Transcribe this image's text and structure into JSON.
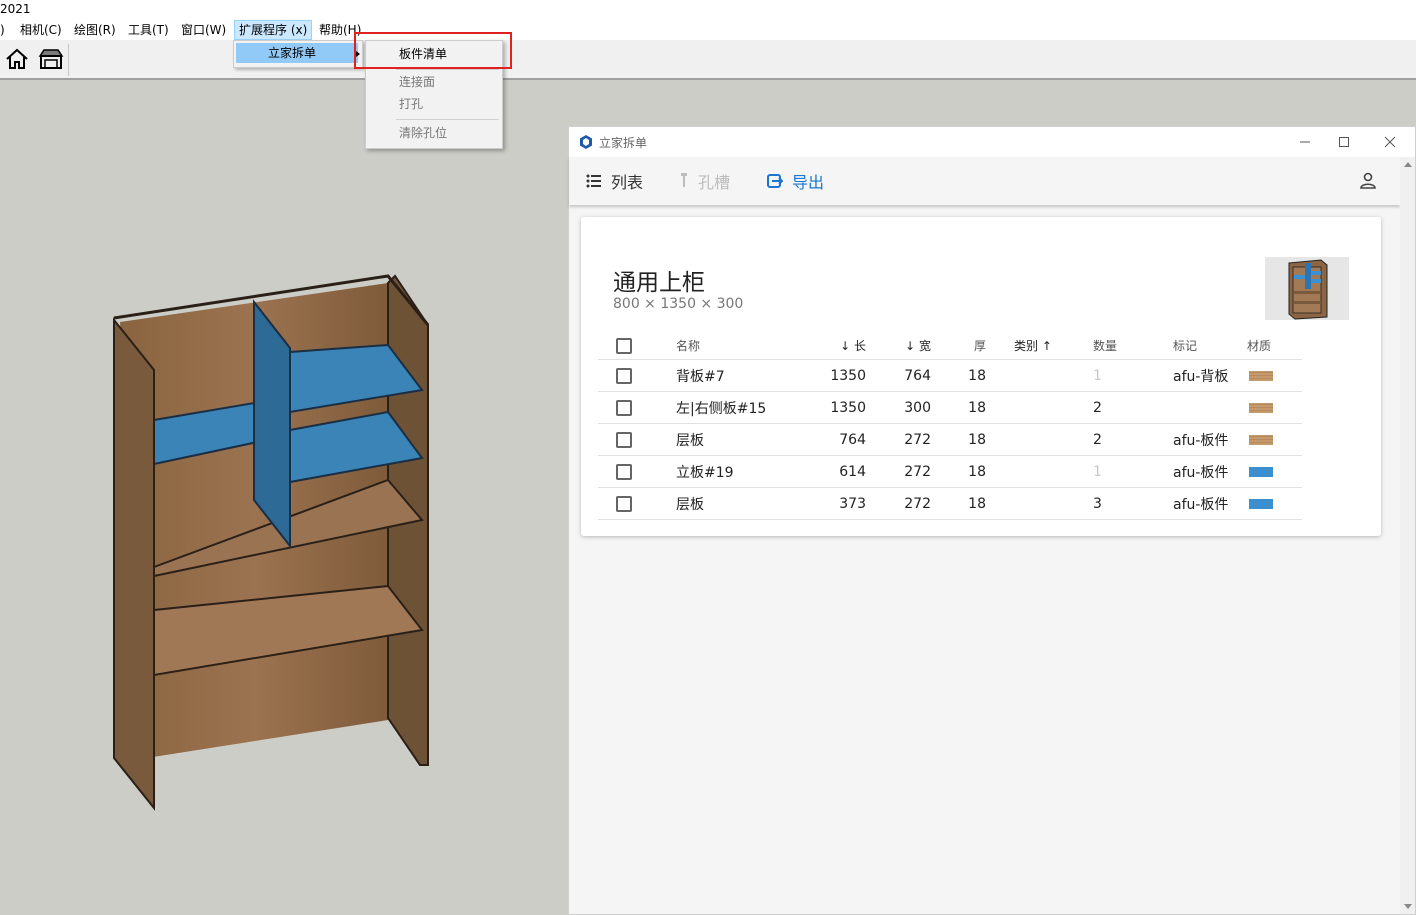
{
  "host": {
    "title_fragment": "2021",
    "menus": [
      {
        "label": ")"
      },
      {
        "label": "相机(C)"
      },
      {
        "label": "绘图(R)"
      },
      {
        "label": "工具(T)"
      },
      {
        "label": "窗口(W)"
      },
      {
        "label": "扩展程序 (x)"
      },
      {
        "label": "帮助(H)"
      }
    ],
    "submenu": {
      "label": "立家拆单"
    },
    "submenu_items": [
      {
        "label": "板件清单"
      },
      {
        "label": "连接面"
      },
      {
        "label": "打孔"
      },
      {
        "label": "清除孔位"
      }
    ],
    "toolbar_icons": [
      "home-icon",
      "warehouse-icon"
    ]
  },
  "plugin": {
    "window_title": "立家拆单",
    "window_controls": [
      "minimize",
      "maximize",
      "close"
    ],
    "toolbar": {
      "list_label": "列表",
      "slot_label": "孔槽",
      "export_label": "导出"
    },
    "cabinet": {
      "name": "通用上柜",
      "dimensions": "800 × 1350 × 300"
    },
    "columns": {
      "name": "名称",
      "length": "长",
      "width": "宽",
      "thickness": "厚",
      "category": "类别",
      "quantity": "数量",
      "mark": "标记",
      "material": "材质"
    },
    "rows": [
      {
        "name": "背板#7",
        "length": "1350",
        "width": "764",
        "thickness": "18",
        "quantity": "1",
        "mark": "afu-背板",
        "material": "wood",
        "qty_dim": true
      },
      {
        "name": "左|右侧板#15",
        "length": "1350",
        "width": "300",
        "thickness": "18",
        "quantity": "2",
        "mark": "",
        "material": "wood",
        "qty_dim": false
      },
      {
        "name": "层板",
        "length": "764",
        "width": "272",
        "thickness": "18",
        "quantity": "2",
        "mark": "afu-板件",
        "material": "wood",
        "qty_dim": false
      },
      {
        "name": "立板#19",
        "length": "614",
        "width": "272",
        "thickness": "18",
        "quantity": "1",
        "mark": "afu-板件",
        "material": "blue",
        "qty_dim": true
      },
      {
        "name": "层板",
        "length": "373",
        "width": "272",
        "thickness": "18",
        "quantity": "3",
        "mark": "afu-板件",
        "material": "blue",
        "qty_dim": false
      }
    ]
  },
  "colors": {
    "accent": "#1976d2",
    "highlight_box": "#e32020",
    "wood_swatch": "#c49a6c",
    "blue_swatch": "#3a8fd0",
    "menu_selected": "#91c9f7"
  }
}
